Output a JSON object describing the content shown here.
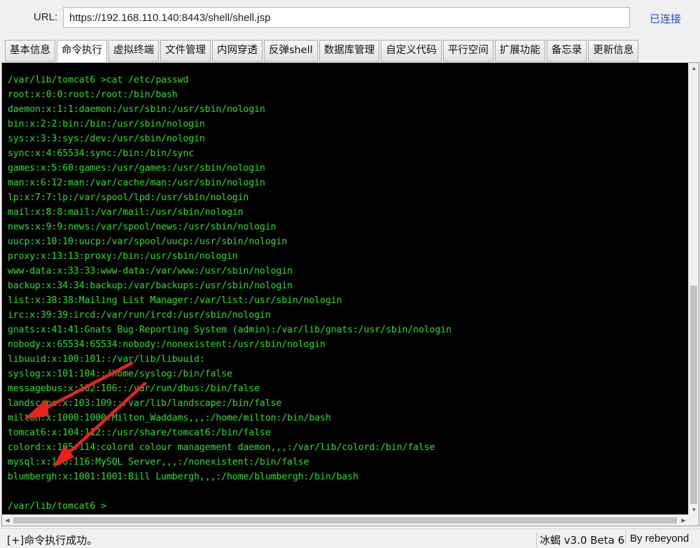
{
  "url_bar": {
    "label": "URL:",
    "value": "https://192.168.110.140:8443/shell/shell.jsp",
    "status": "已连接"
  },
  "tabs": [
    {
      "label": "基本信息"
    },
    {
      "label": "命令执行",
      "active": true
    },
    {
      "label": "虚拟终端"
    },
    {
      "label": "文件管理"
    },
    {
      "label": "内网穿透"
    },
    {
      "label": "反弹shell"
    },
    {
      "label": "数据库管理"
    },
    {
      "label": "自定义代码"
    },
    {
      "label": "平行空间"
    },
    {
      "label": "扩展功能"
    },
    {
      "label": "备忘录"
    },
    {
      "label": "更新信息"
    }
  ],
  "terminal": {
    "lines": [
      "/var/lib/tomcat6 >cat /etc/passwd",
      "root:x:0:0:root:/root:/bin/bash",
      "daemon:x:1:1:daemon:/usr/sbin:/usr/sbin/nologin",
      "bin:x:2:2:bin:/bin:/usr/sbin/nologin",
      "sys:x:3:3:sys:/dev:/usr/sbin/nologin",
      "sync:x:4:65534:sync:/bin:/bin/sync",
      "games:x:5:60:games:/usr/games:/usr/sbin/nologin",
      "man:x:6:12:man:/var/cache/man:/usr/sbin/nologin",
      "lp:x:7:7:lp:/var/spool/lpd:/usr/sbin/nologin",
      "mail:x:8:8:mail:/var/mail:/usr/sbin/nologin",
      "news:x:9:9:news:/var/spool/news:/usr/sbin/nologin",
      "uucp:x:10:10:uucp:/var/spool/uucp:/usr/sbin/nologin",
      "proxy:x:13:13:proxy:/bin:/usr/sbin/nologin",
      "www-data:x:33:33:www-data:/var/www:/usr/sbin/nologin",
      "backup:x:34:34:backup:/var/backups:/usr/sbin/nologin",
      "list:x:38:38:Mailing List Manager:/var/list:/usr/sbin/nologin",
      "irc:x:39:39:ircd:/var/run/ircd:/usr/sbin/nologin",
      "gnats:x:41:41:Gnats Bug-Reporting System (admin):/var/lib/gnats:/usr/sbin/nologin",
      "nobody:x:65534:65534:nobody:/nonexistent:/usr/sbin/nologin",
      "libuuid:x:100:101::/var/lib/libuuid:",
      "syslog:x:101:104::/home/syslog:/bin/false",
      "messagebus:x:102:106::/var/run/dbus:/bin/false",
      "landscape:x:103:109::/var/lib/landscape:/bin/false",
      "milton:x:1000:1000:Milton_Waddams,,,:/home/milton:/bin/bash",
      "tomcat6:x:104:112::/usr/share/tomcat6:/bin/false",
      "colord:x:105:114:colord colour management daemon,,,:/var/lib/colord:/bin/false",
      "mysql:x:106:116:MySQL Server,,,:/nonexistent:/bin/false",
      "blumbergh:x:1001:1001:Bill Lumbergh,,,:/home/blumbergh:/bin/bash",
      "",
      "/var/lib/tomcat6 >"
    ]
  },
  "statusbar": {
    "message": "[+]命令执行成功。",
    "version": "冰蝎 v3.0 Beta 6",
    "author": "By rebeyond"
  },
  "colors": {
    "terminal_bg": "#000000",
    "terminal_text": "#19e619",
    "annotation_arrow": "#e8231e",
    "link": "#1a55c8"
  }
}
